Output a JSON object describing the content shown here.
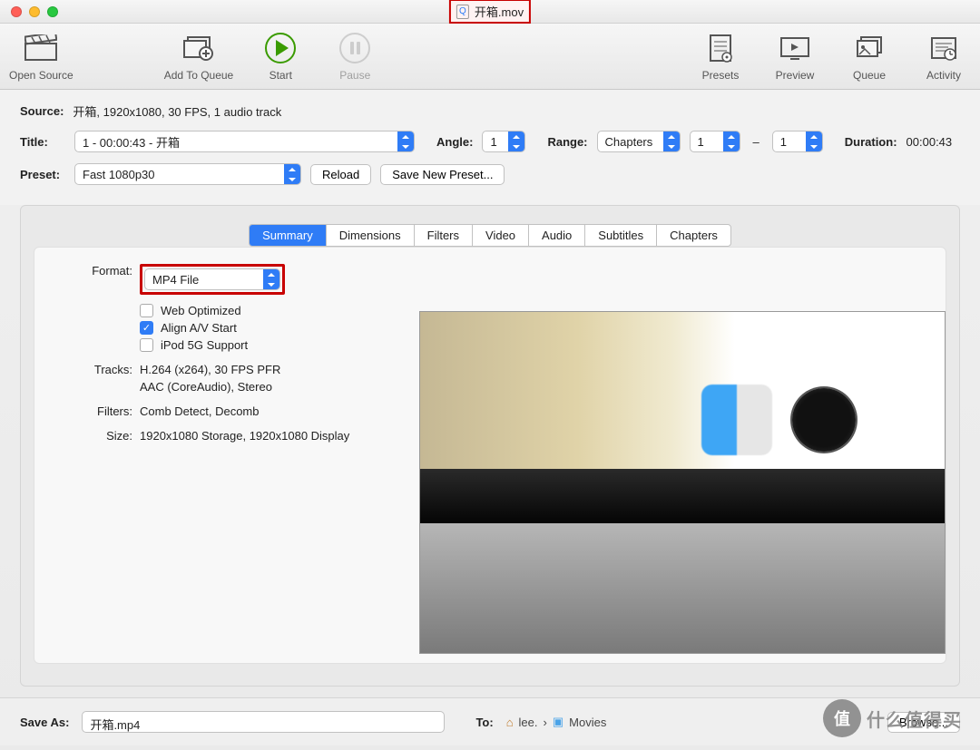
{
  "window": {
    "title": "开箱.mov"
  },
  "toolbar": {
    "open_source": "Open Source",
    "add_queue": "Add To Queue",
    "start": "Start",
    "pause": "Pause",
    "presets": "Presets",
    "preview": "Preview",
    "queue": "Queue",
    "activity": "Activity"
  },
  "source": {
    "label": "Source:",
    "value": "开箱, 1920x1080, 30 FPS, 1 audio track"
  },
  "titlebox": {
    "label": "Title:",
    "value": "1 - 00:00:43 - 开箱"
  },
  "angle": {
    "label": "Angle:",
    "value": "1"
  },
  "range": {
    "label": "Range:",
    "type": "Chapters",
    "from": "1",
    "to": "1"
  },
  "duration": {
    "label": "Duration:",
    "value": "00:00:43"
  },
  "preset": {
    "label": "Preset:",
    "value": "Fast 1080p30",
    "reload": "Reload",
    "save_new": "Save New Preset..."
  },
  "tabs": [
    "Summary",
    "Dimensions",
    "Filters",
    "Video",
    "Audio",
    "Subtitles",
    "Chapters"
  ],
  "summary": {
    "format_label": "Format:",
    "format_value": "MP4 File",
    "web_opt": "Web Optimized",
    "align_av": "Align A/V Start",
    "ipod": "iPod 5G Support",
    "tracks_label": "Tracks:",
    "tracks_v": "H.264 (x264), 30 FPS PFR",
    "tracks_a": "AAC (CoreAudio), Stereo",
    "filters_label": "Filters:",
    "filters_value": "Comb Detect, Decomb",
    "size_label": "Size:",
    "size_value": "1920x1080 Storage, 1920x1080 Display"
  },
  "save": {
    "label": "Save As:",
    "value": "开箱.mp4",
    "to_label": "To:",
    "user": "lee.",
    "folder": "Movies",
    "browse": "Browse..."
  },
  "watermark": "什么值得买"
}
